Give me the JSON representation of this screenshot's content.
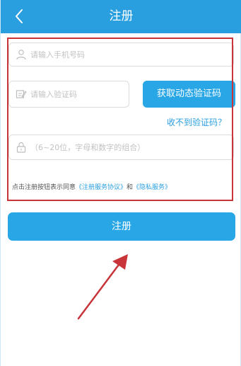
{
  "header": {
    "title": "注册",
    "back_icon": "chevron-left-icon"
  },
  "form": {
    "phone_placeholder": "请输入手机号码",
    "code_placeholder": "请输入验证码",
    "get_code_label": "获取动态验证码",
    "no_code_label": "收不到验证码？",
    "password_placeholder": "（6~20位，字母和数字的组合）",
    "agreement": {
      "prefix": "点击注册按钮表示同意",
      "terms_link": "《注册服务协议》",
      "conjunction": "和",
      "privacy_link": "《隐私服务》"
    },
    "submit_label": "注册"
  },
  "colors": {
    "accent": "#2a9fe0",
    "annotation": "#c9333a"
  },
  "icons": {
    "phone_field": "user-icon",
    "code_field": "message-edit-icon",
    "password_field": "lock-icon",
    "annotation_arrow": "arrow-icon"
  }
}
